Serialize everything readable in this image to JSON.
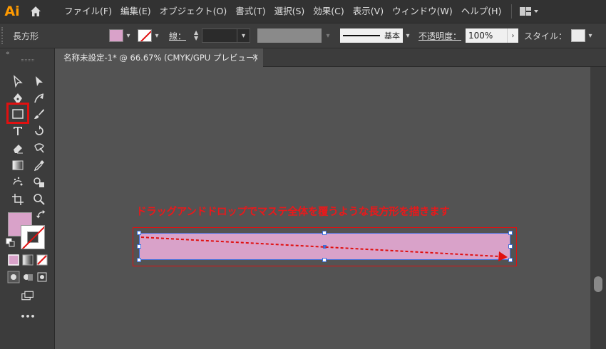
{
  "app": {
    "logo": "Ai"
  },
  "menu": [
    "ファイル(F)",
    "編集(E)",
    "オブジェクト(O)",
    "書式(T)",
    "選択(S)",
    "効果(C)",
    "表示(V)",
    "ウィンドウ(W)",
    "ヘルプ(H)"
  ],
  "control": {
    "object_label": "長方形",
    "stroke_label": "線：",
    "stroke_style_label": "基本",
    "opacity_label": "不透明度：",
    "opacity_value": "100%",
    "style_label": "スタイル："
  },
  "document": {
    "tab_title": "名称未設定-1* @ 66.67% (CMYK/GPU プレビュー)",
    "close": "×"
  },
  "toolbar": {
    "more": "•••"
  },
  "annotation": {
    "text": "ドラッグアンドドロップでマステ全体を覆うような長方形を描きます"
  },
  "colors": {
    "fill": "#d9a2c9",
    "accent_red": "#e01010",
    "selection": "#3f6fdc",
    "logo": "#ff9a00"
  }
}
